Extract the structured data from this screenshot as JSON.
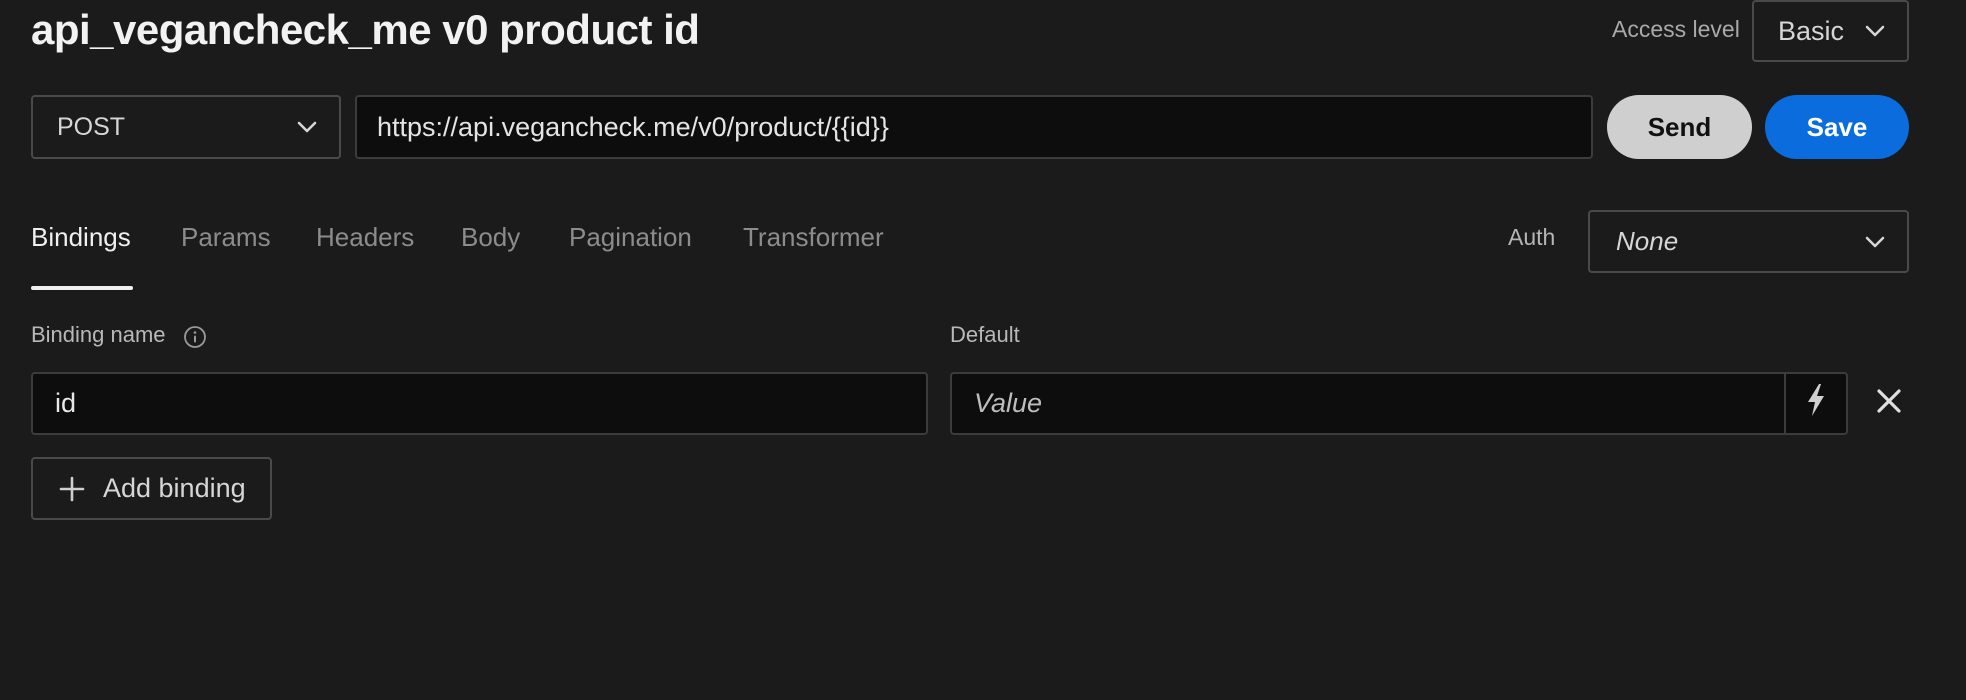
{
  "header": {
    "title": "api_vegancheck_me v0 product id",
    "access_level_label": "Access level",
    "access_level_value": "Basic"
  },
  "request": {
    "method": "POST",
    "url": "https://api.vegancheck.me/v0/product/{{id}}",
    "send_label": "Send",
    "save_label": "Save"
  },
  "tabs": [
    {
      "label": "Bindings",
      "active": true
    },
    {
      "label": "Params",
      "active": false
    },
    {
      "label": "Headers",
      "active": false
    },
    {
      "label": "Body",
      "active": false
    },
    {
      "label": "Pagination",
      "active": false
    },
    {
      "label": "Transformer",
      "active": false
    }
  ],
  "auth": {
    "label": "Auth",
    "value": "None"
  },
  "bindings": {
    "name_label": "Binding name",
    "default_label": "Default",
    "rows": [
      {
        "name": "id",
        "default_placeholder": "Value"
      }
    ],
    "add_label": "Add binding"
  },
  "icons": {
    "dropdown": "chevron-down-icon",
    "info": "info-icon",
    "dynamic": "lightning-bolt-icon",
    "remove": "close-icon",
    "add": "plus-icon"
  },
  "colors": {
    "background": "#1b1b1c",
    "input_background": "#0d0d0d",
    "primary": "#0b6cdd",
    "send": "#cfcfcf"
  }
}
